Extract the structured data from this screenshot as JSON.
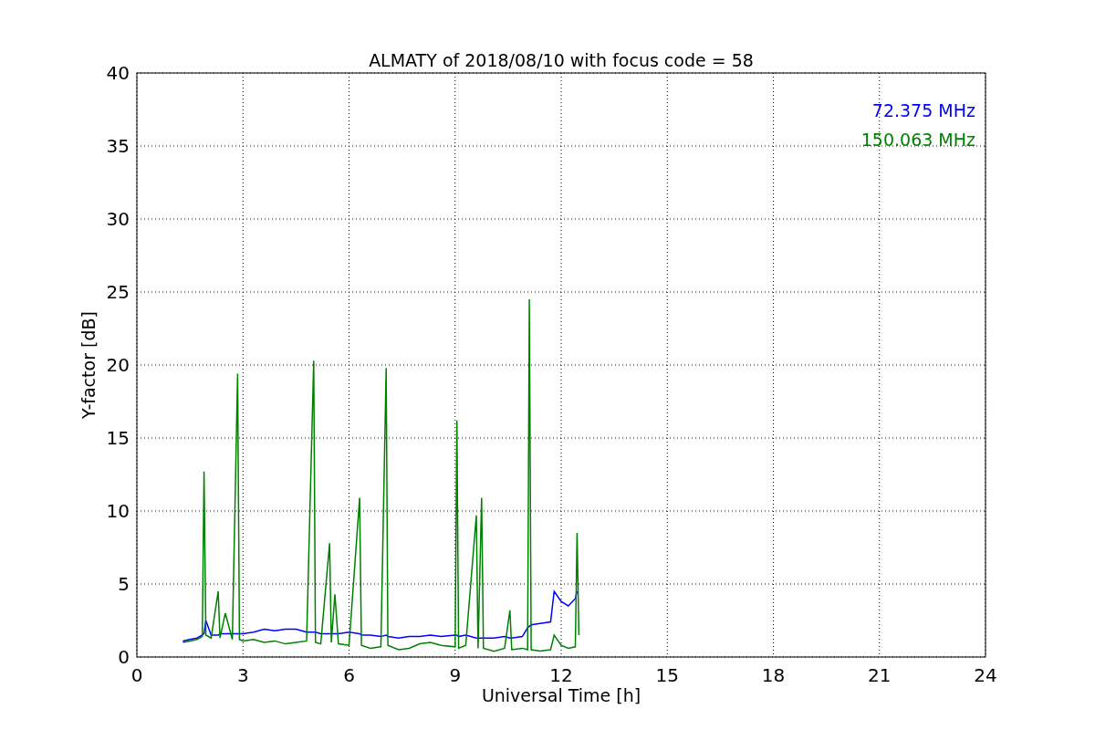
{
  "chart_data": {
    "type": "line",
    "title": "ALMATY of 2018/08/10 with focus code = 58",
    "xlabel": "Universal Time [h]",
    "ylabel": "Y-factor [dB]",
    "x": [
      1.3,
      1.5,
      1.7,
      1.85,
      1.9,
      1.95,
      2.1,
      2.3,
      2.35,
      2.5,
      2.7,
      2.85,
      2.9,
      3.0,
      3.3,
      3.6,
      3.9,
      4.2,
      4.5,
      4.8,
      5.0,
      5.05,
      5.2,
      5.45,
      5.5,
      5.6,
      5.7,
      6.0,
      6.3,
      6.35,
      6.6,
      6.9,
      7.05,
      7.1,
      7.4,
      7.7,
      8.0,
      8.3,
      8.6,
      9.0,
      9.05,
      9.1,
      9.3,
      9.6,
      9.65,
      9.75,
      9.8,
      10.1,
      10.4,
      10.55,
      10.6,
      10.9,
      11.05,
      11.1,
      11.15,
      11.4,
      11.7,
      11.8,
      12.0,
      12.2,
      12.4,
      12.45,
      12.5
    ],
    "series": [
      {
        "name": "72.375 MHz",
        "color": "#0000ff",
        "values": [
          1.1,
          1.2,
          1.3,
          1.5,
          1.6,
          2.5,
          1.5,
          1.5,
          1.6,
          1.6,
          1.6,
          1.6,
          1.6,
          1.6,
          1.7,
          1.9,
          1.8,
          1.9,
          1.9,
          1.7,
          1.7,
          1.7,
          1.6,
          1.6,
          1.6,
          1.6,
          1.6,
          1.7,
          1.6,
          1.5,
          1.5,
          1.4,
          1.5,
          1.4,
          1.3,
          1.4,
          1.4,
          1.5,
          1.4,
          1.5,
          1.5,
          1.4,
          1.5,
          1.3,
          1.3,
          1.3,
          1.3,
          1.3,
          1.4,
          1.3,
          1.3,
          1.4,
          2.0,
          2.1,
          2.2,
          2.3,
          2.4,
          4.5,
          3.8,
          3.5,
          4.0,
          4.5,
          null
        ]
      },
      {
        "name": "150.063 MHz",
        "color": "#008000",
        "values": [
          1.0,
          1.1,
          1.2,
          1.4,
          12.7,
          1.5,
          1.3,
          4.5,
          1.3,
          3.0,
          1.2,
          19.4,
          1.2,
          1.1,
          1.2,
          1.0,
          1.1,
          0.9,
          1.0,
          1.1,
          20.3,
          1.0,
          0.9,
          7.8,
          1.0,
          4.3,
          0.9,
          0.8,
          10.9,
          0.8,
          0.6,
          0.7,
          19.8,
          0.8,
          0.5,
          0.6,
          0.9,
          1.0,
          0.8,
          0.7,
          16.2,
          0.6,
          0.8,
          9.7,
          0.6,
          10.9,
          0.6,
          0.4,
          0.6,
          3.2,
          0.5,
          0.6,
          0.5,
          24.5,
          0.5,
          0.4,
          0.5,
          1.5,
          0.8,
          0.6,
          0.7,
          8.5,
          1.5
        ]
      }
    ],
    "grid": true,
    "xlim": [
      0,
      24
    ],
    "ylim": [
      0,
      40
    ],
    "xticks": [
      0,
      3,
      6,
      9,
      12,
      15,
      18,
      21,
      24
    ],
    "yticks": [
      0,
      5,
      10,
      15,
      20,
      25,
      30,
      35,
      40
    ]
  }
}
